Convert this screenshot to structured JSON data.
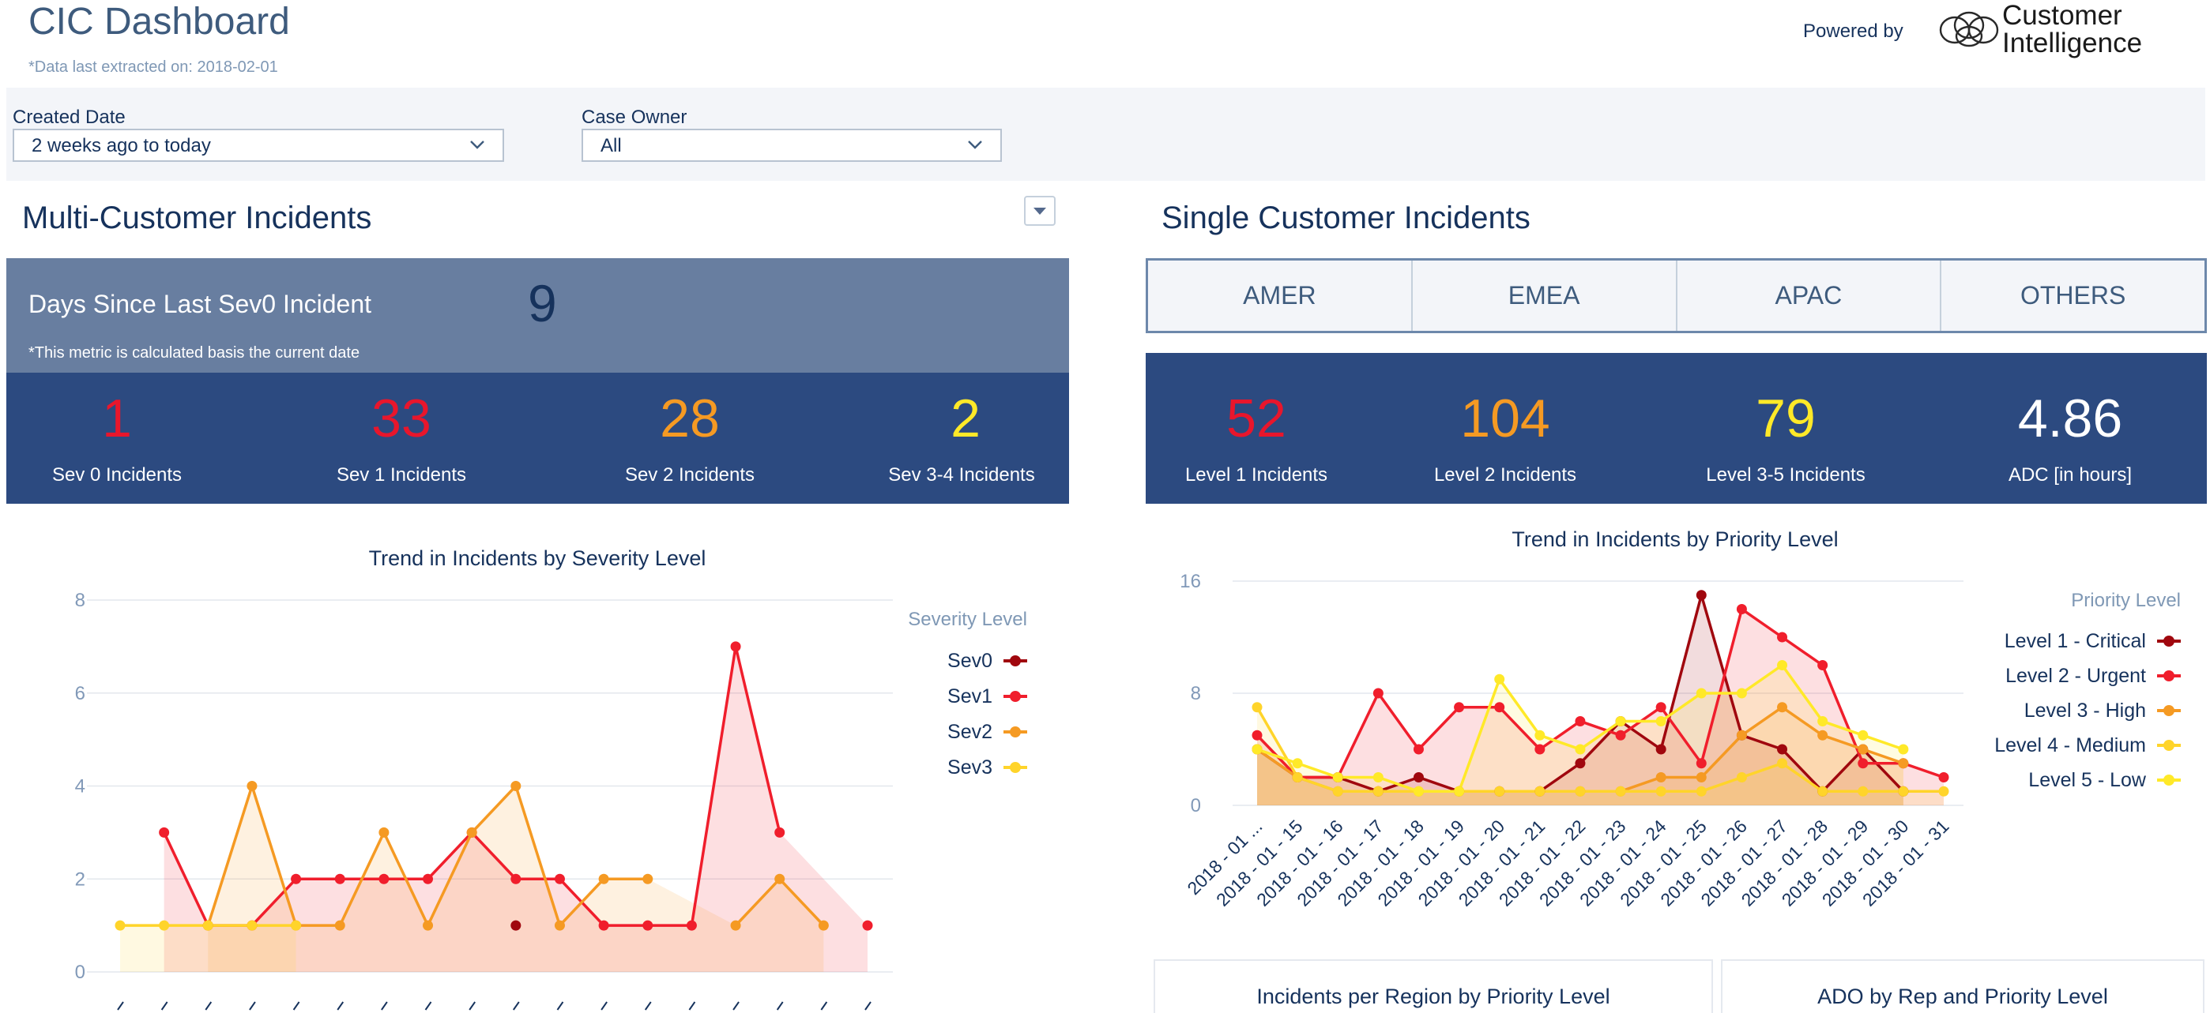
{
  "header": {
    "title": "CIC Dashboard",
    "subtitle": "*Data last extracted on: 2018-02-01",
    "powered_by": "Powered by",
    "logo_line1": "Customer",
    "logo_line2": "Intelligence"
  },
  "filters": {
    "created_date": {
      "label": "Created Date",
      "value": "2 weeks ago to today"
    },
    "case_owner": {
      "label": "Case Owner",
      "value": "All"
    }
  },
  "multi": {
    "title": "Multi-Customer Incidents",
    "days_label": "Days Since Last Sev0 Incident",
    "days_value": "9",
    "days_note": "*This metric is calculated basis the current date",
    "kpis": [
      {
        "value": "1",
        "label": "Sev 0 Incidents",
        "color": "#e8162c"
      },
      {
        "value": "33",
        "label": "Sev 1 Incidents",
        "color": "#e8162c"
      },
      {
        "value": "28",
        "label": "Sev 2 Incidents",
        "color": "#f59a23"
      },
      {
        "value": "2",
        "label": "Sev 3-4 Incidents",
        "color": "#ffe928"
      }
    ]
  },
  "single": {
    "title": "Single Customer Incidents",
    "tabs": [
      "AMER",
      "EMEA",
      "APAC",
      "OTHERS"
    ],
    "kpis": [
      {
        "value": "52",
        "label": "Level 1 Incidents",
        "color": "#e8162c"
      },
      {
        "value": "104",
        "label": "Level 2 Incidents",
        "color": "#f59a23"
      },
      {
        "value": "79",
        "label": "Level 3-5 Incidents",
        "color": "#ffe928"
      },
      {
        "value": "4.86",
        "label": "ADC [in hours]",
        "color": "#ffffff"
      }
    ]
  },
  "bottom_cards": {
    "left_title": "Incidents per Region by Priority Level",
    "right_title": "ADO by Rep and Priority Level"
  },
  "chart_data": [
    {
      "type": "line",
      "title": "Trend in Incidents by Severity Level",
      "legend_title": "Severity Level",
      "legend_position": "right",
      "ylim": [
        0,
        8
      ],
      "yticks": [
        0,
        2,
        4,
        6,
        8
      ],
      "grid": true,
      "x_count": 18,
      "series": [
        {
          "name": "Sev0",
          "color": "#a0070e",
          "values": [
            null,
            null,
            null,
            null,
            null,
            null,
            null,
            null,
            null,
            1,
            null,
            null,
            null,
            null,
            null,
            null,
            null,
            null
          ]
        },
        {
          "name": "Sev1",
          "color": "#f01e2c",
          "values": [
            null,
            3,
            1,
            1,
            2,
            2,
            2,
            2,
            3,
            2,
            2,
            1,
            1,
            1,
            7,
            3,
            null,
            1
          ]
        },
        {
          "name": "Sev2",
          "color": "#f59a23",
          "values": [
            null,
            null,
            1,
            4,
            1,
            1,
            3,
            1,
            3,
            4,
            1,
            2,
            2,
            null,
            1,
            2,
            1,
            null
          ]
        },
        {
          "name": "Sev3",
          "color": "#ffd42a",
          "values": [
            1,
            1,
            1,
            1,
            1,
            null,
            null,
            null,
            null,
            null,
            null,
            null,
            null,
            null,
            null,
            null,
            null,
            null
          ]
        }
      ]
    },
    {
      "type": "line",
      "title": "Trend in Incidents by Priority Level",
      "legend_title": "Priority Level",
      "legend_position": "right",
      "ylim": [
        0,
        16
      ],
      "yticks": [
        0,
        8,
        16
      ],
      "grid": true,
      "categories": [
        "2018 - 01 ...",
        "2018 - 01 - 15",
        "2018 - 01 - 16",
        "2018 - 01 - 17",
        "2018 - 01 - 18",
        "2018 - 01 - 19",
        "2018 - 01 - 20",
        "2018 - 01 - 21",
        "2018 - 01 - 22",
        "2018 - 01 - 23",
        "2018 - 01 - 24",
        "2018 - 01 - 25",
        "2018 - 01 - 26",
        "2018 - 01 - 27",
        "2018 - 01 - 28",
        "2018 - 01 - 29",
        "2018 - 01 - 30",
        "2018 - 01 - 31"
      ],
      "series": [
        {
          "name": "Level 1 - Critical",
          "color": "#a0070e",
          "values": [
            4,
            2,
            2,
            1,
            2,
            1,
            1,
            1,
            3,
            6,
            4,
            15,
            5,
            4,
            1,
            4,
            1,
            null
          ]
        },
        {
          "name": "Level 2 - Urgent",
          "color": "#f01e2c",
          "values": [
            5,
            2,
            2,
            8,
            4,
            7,
            7,
            4,
            6,
            5,
            7,
            3,
            14,
            12,
            10,
            3,
            3,
            2
          ]
        },
        {
          "name": "Level 3 - High",
          "color": "#f59a23",
          "values": [
            4,
            2,
            1,
            1,
            1,
            1,
            1,
            1,
            1,
            1,
            2,
            2,
            5,
            7,
            5,
            4,
            3,
            null
          ]
        },
        {
          "name": "Level 4 - Medium",
          "color": "#ffd42a",
          "values": [
            7,
            2,
            1,
            1,
            1,
            1,
            1,
            1,
            1,
            1,
            1,
            1,
            2,
            3,
            1,
            1,
            1,
            1
          ]
        },
        {
          "name": "Level 5 - Low",
          "color": "#ffe928",
          "values": [
            4,
            3,
            2,
            2,
            1,
            1,
            9,
            5,
            4,
            6,
            6,
            8,
            8,
            10,
            6,
            5,
            4,
            null
          ]
        }
      ]
    }
  ]
}
